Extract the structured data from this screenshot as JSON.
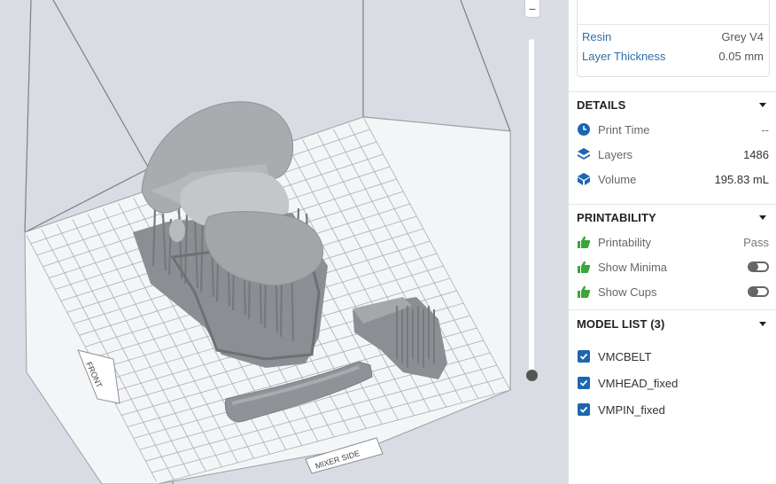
{
  "material": {
    "resin_label": "Resin",
    "resin_value": "Grey V4",
    "layer_label": "Layer Thickness",
    "layer_value": "0.05 mm"
  },
  "details": {
    "title": "DETAILS",
    "print_time_label": "Print Time",
    "print_time_value": "--",
    "layers_label": "Layers",
    "layers_value": "1486",
    "volume_label": "Volume",
    "volume_value": "195.83 mL"
  },
  "printability": {
    "title": "PRINTABILITY",
    "printability_label": "Printability",
    "printability_value": "Pass",
    "minima_label": "Show Minima",
    "minima_on": false,
    "cups_label": "Show Cups",
    "cups_on": false
  },
  "model_list": {
    "title": "MODEL LIST (3)",
    "items": [
      {
        "name": "VMCBELT",
        "checked": true
      },
      {
        "name": "VMHEAD_fixed",
        "checked": true
      },
      {
        "name": "VMPIN_fixed",
        "checked": true
      }
    ]
  },
  "viewport": {
    "zoom_symbol": "−",
    "front_label": "FRONT",
    "side_label": "MIXER SIDE",
    "slider_level": 1.0
  },
  "colors": {
    "accent": "#1d67b0",
    "link": "#2f6fa8",
    "pass_green": "#3aa53a",
    "build_bg": "#d9dde3"
  }
}
